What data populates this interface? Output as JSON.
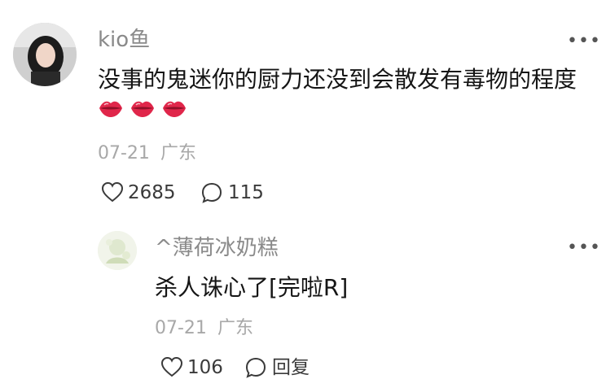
{
  "comment": {
    "username": "kio鱼",
    "text": "没事的鬼迷你的厨力还没到会散发有毒物的程度",
    "emojis": [
      "lips-icon",
      "lips-icon",
      "lips-icon"
    ],
    "date": "07-21",
    "location": "广东",
    "likes": "2685",
    "replies": "115"
  },
  "reply": {
    "username": "^薄荷冰奶糕",
    "text": "杀人诛心了[完啦R]",
    "date": "07-21",
    "location": "广东",
    "likes": "106",
    "reply_label": "回复"
  },
  "colors": {
    "lips": "#e0264a",
    "muted": "#a8a8a8"
  }
}
